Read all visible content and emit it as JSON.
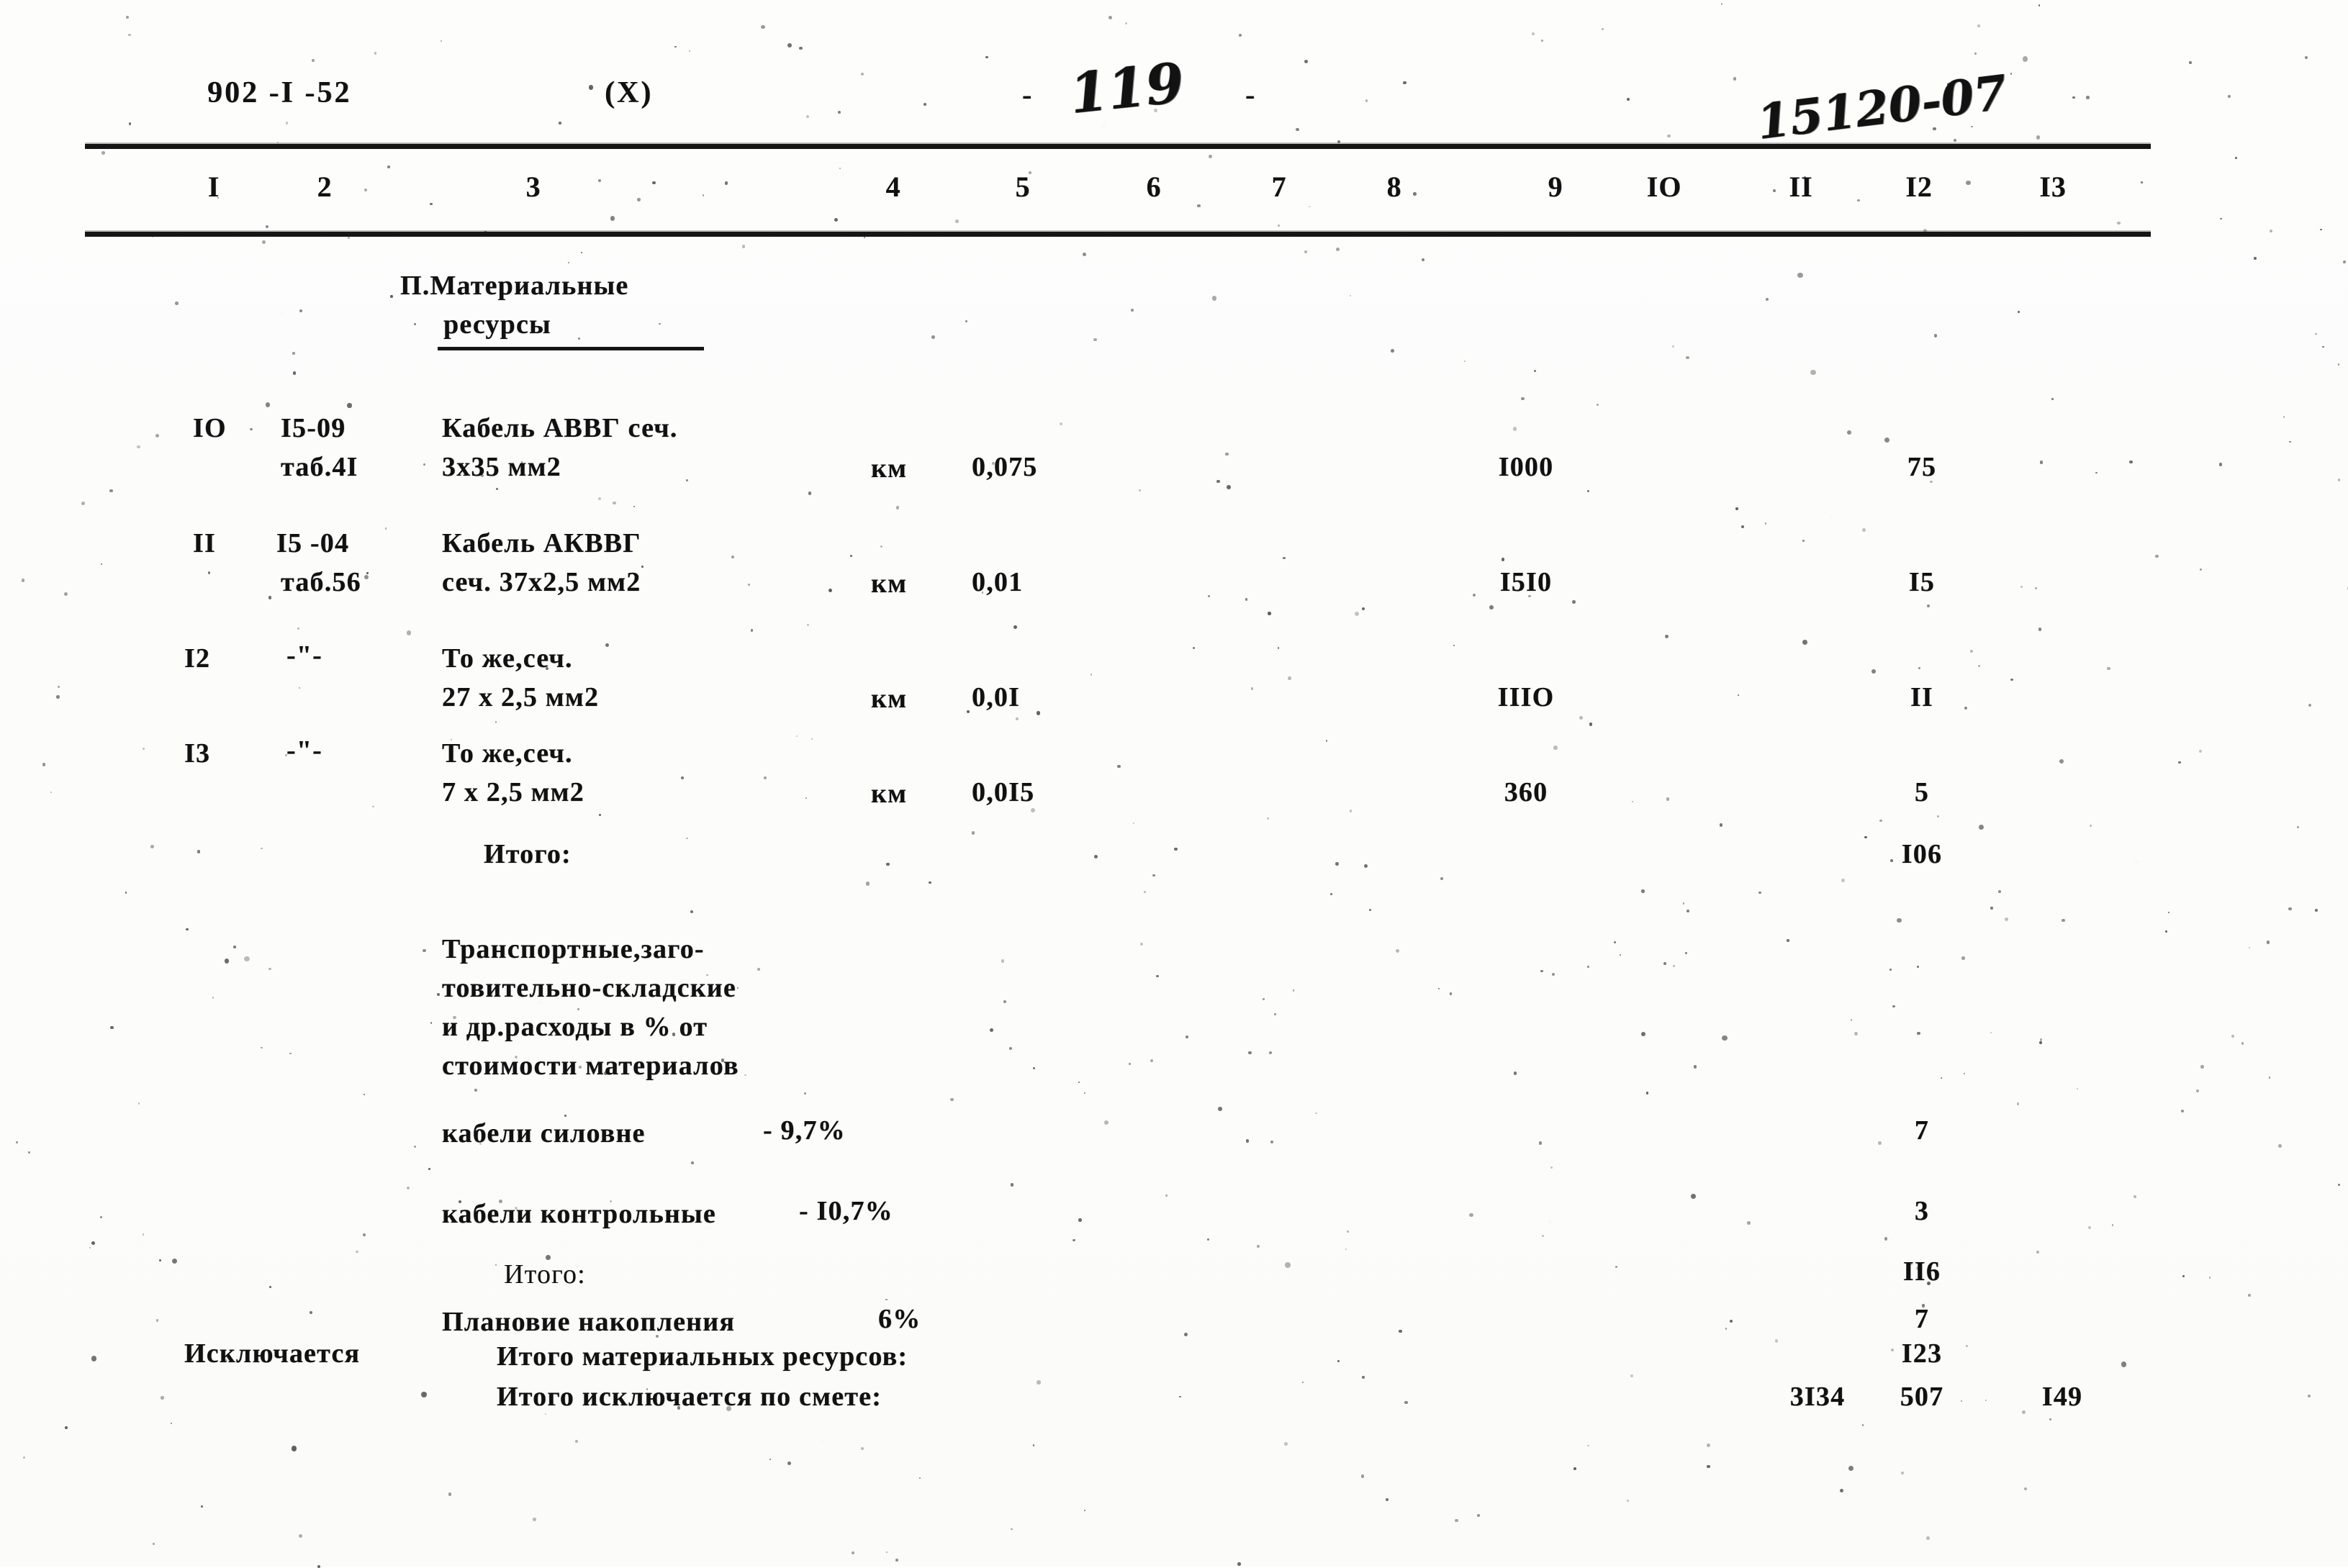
{
  "document": {
    "series_code": "902 -I -52",
    "revision_mark": "(X)",
    "page_number_handwritten": "119",
    "page_dash_left": "-",
    "page_dash_right": "-",
    "stamp_number_handwritten": "15120-07"
  },
  "table": {
    "column_headers": [
      "I",
      "2",
      "3",
      "4",
      "5",
      "6",
      "7",
      "8",
      "9",
      "IO",
      "II",
      "I2",
      "I3"
    ],
    "section_title_line1": "П.Материальные",
    "section_title_line2": "ресурсы",
    "rows": [
      {
        "num": "IO",
        "code_line1": "I5-09",
        "code_line2": "таб.4I",
        "name_line1": "Кабель АВВГ сеч.",
        "name_line2": "3х35 мм2",
        "unit": "км",
        "qty": "0,075",
        "col9": "I000",
        "col12": "75"
      },
      {
        "num": "II",
        "code_line1": "I5 -04",
        "code_line2": "таб.56",
        "name_line1": "Кабель АКВВГ",
        "name_line2": "сеч. 37х2,5 мм2",
        "unit": "км",
        "qty": "0,01",
        "col9": "I5I0",
        "col12": "I5"
      },
      {
        "num": "I2",
        "code_line1": "-\"-",
        "code_line2": "",
        "name_line1": "То же,сеч.",
        "name_line2": "27 х 2,5 мм2",
        "unit": "км",
        "qty": "0,0I",
        "col9": "IIIO",
        "col12": "II"
      },
      {
        "num": "I3",
        "code_line1": "-\"-",
        "code_line2": "",
        "name_line1": "То же,сеч.",
        "name_line2": "7 х 2,5 мм2",
        "unit": "км",
        "qty": "0,0I5",
        "col9": "360",
        "col12": "5"
      }
    ],
    "subtotal": {
      "label": "Итого:",
      "col12": "I06"
    },
    "overhead_note": {
      "line1": "Транспортные,заго-",
      "line2": "товительно-складские",
      "line3": "и др.расходы в % от",
      "line4": "стоимости материалов"
    },
    "overhead_rows": [
      {
        "label": "кабели силовне",
        "rate": "- 9,7%",
        "col12": "7"
      },
      {
        "label": "кабели контрольные",
        "rate": "- I0,7%",
        "col12": "3"
      }
    ],
    "total2": {
      "label": "Итого:",
      "col12": "II6"
    },
    "planned_savings": {
      "label": "Плановие накопления",
      "rate": "6%",
      "col12": "7"
    },
    "excluded_label": "Исключается",
    "materials_total": {
      "label": "Итого материальных ресурсов:",
      "col12": "I23"
    },
    "estimate_total": {
      "label": "Итого исключается по смете:",
      "col11": "3I34",
      "col12": "507",
      "col13": "I49"
    }
  }
}
